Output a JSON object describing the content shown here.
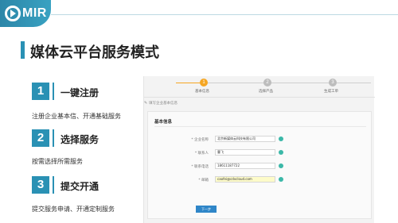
{
  "brand": {
    "logo_text": "MIR",
    "accent": "#2a91b4",
    "icon": "play-circle-icon"
  },
  "page": {
    "title": "媒体云平台服务模式"
  },
  "steps": [
    {
      "num": "1",
      "title": "一键注册",
      "desc": "注册企业基本信、开通基础服务"
    },
    {
      "num": "2",
      "title": "选择服务",
      "desc": "按需选择所需服务"
    },
    {
      "num": "3",
      "title": "提交开通",
      "desc": "提交服务申请、开通定制服务"
    }
  ],
  "screenshot": {
    "progress": [
      {
        "num": "1",
        "label": "基本信息",
        "active": true
      },
      {
        "num": "2",
        "label": "选择产品",
        "active": false
      },
      {
        "num": "3",
        "label": "生成工单",
        "active": false
      }
    ],
    "breadcrumb": "填写企业基本信息",
    "form_title": "基本信息",
    "fields": [
      {
        "label": "* 企业名称",
        "value": "北京新媒体云科技有限公司"
      },
      {
        "label": "* 联系人",
        "value": "曹飞"
      },
      {
        "label": "* 联系电话",
        "value": "18611187722"
      },
      {
        "label": "* 邮箱",
        "value": "caofei@cdvcloud.com"
      }
    ],
    "next_label": "下一步"
  }
}
